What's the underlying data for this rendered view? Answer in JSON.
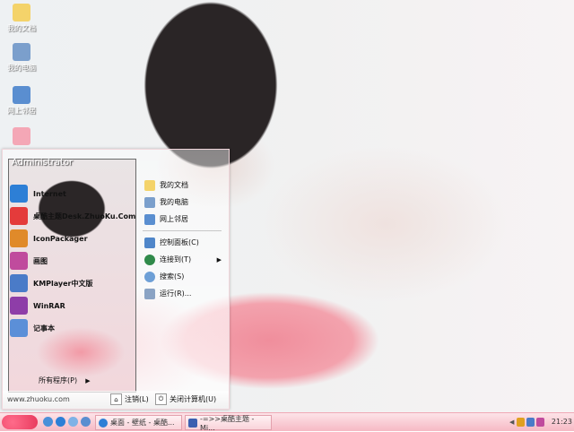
{
  "desktop": {
    "icons": [
      {
        "label": "我的文档",
        "icon": "folder-icon",
        "color": "#f4d36a"
      },
      {
        "label": "我的电脑",
        "icon": "computer-icon",
        "color": "#7b9fcc"
      },
      {
        "label": "网上邻居",
        "icon": "network-icon",
        "color": "#5a8ed0"
      },
      {
        "label": "",
        "icon": "recycle-bin-icon",
        "color": "#f4a7b6"
      }
    ]
  },
  "start_menu": {
    "user": "Administrator",
    "programs": [
      {
        "label": "Internet",
        "icon": "ie-icon",
        "color": "#2d7fd6"
      },
      {
        "label": "桌酷主题Desk.ZhuoKu.Com",
        "icon": "zhuoku-icon",
        "color": "#e43b3b"
      },
      {
        "label": "IconPackager",
        "icon": "iconpackager-icon",
        "color": "#e08a2a"
      },
      {
        "label": "画图",
        "icon": "paint-icon",
        "color": "#c04b9d"
      },
      {
        "label": "KMPlayer中文版",
        "icon": "kmplayer-icon",
        "color": "#4a7bc8"
      },
      {
        "label": "WinRAR",
        "icon": "winrar-icon",
        "color": "#8e3da8"
      },
      {
        "label": "记事本",
        "icon": "notepad-icon",
        "color": "#5b8fd8"
      }
    ],
    "all_programs": "所有程序(P)",
    "places": [
      {
        "label": "我的文档",
        "icon": "folder-icon",
        "color": "#f4d36a"
      },
      {
        "label": "我的电脑",
        "icon": "computer-icon",
        "color": "#7b9fcc"
      },
      {
        "label": "网上邻居",
        "icon": "network-icon",
        "color": "#5a8ed0"
      }
    ],
    "system": [
      {
        "label": "控制面板(C)",
        "icon": "control-panel-icon",
        "color": "#4f86c9"
      },
      {
        "label": "连接到(T)",
        "icon": "connect-icon",
        "color": "#2f8a4a",
        "submenu": true
      },
      {
        "label": "搜索(S)",
        "icon": "search-icon",
        "color": "#6d9fd6"
      },
      {
        "label": "运行(R)...",
        "icon": "run-icon",
        "color": "#8aa3c4"
      }
    ],
    "website": "www.zhuoku.com",
    "logoff": "注销(L)",
    "shutdown": "关闭计算机(U)"
  },
  "taskbar": {
    "tasks": [
      {
        "label": "桌面 - 壁纸 - 桌酷...",
        "icon": "browser-icon",
        "color": "#2d7fd6"
      },
      {
        "label": "-=>>桌酷主题 - Mi...",
        "icon": "word-icon",
        "color": "#3b5fb0"
      }
    ],
    "clock": "21:23"
  }
}
